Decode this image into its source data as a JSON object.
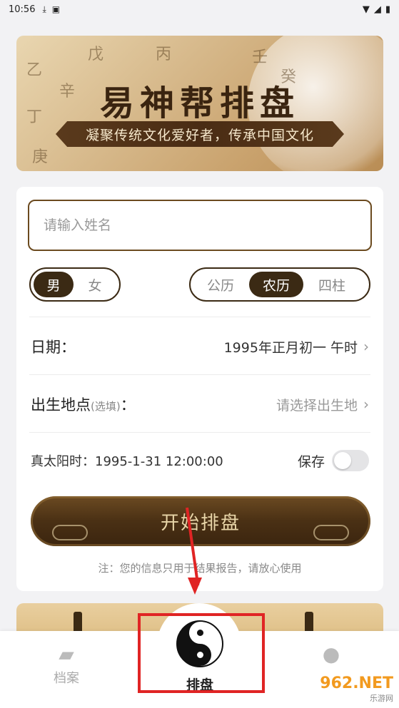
{
  "status_bar": {
    "time": "10:56",
    "icons": [
      "download-icon",
      "a-icon"
    ],
    "right_icons": [
      "wifi-icon",
      "signal-icon",
      "battery-icon"
    ]
  },
  "banner": {
    "title": "易神帮排盘",
    "subtitle": "凝聚传统文化爱好者，传承中国文化",
    "bg_chars": [
      "戊",
      "丙",
      "乙",
      "辛",
      "丁",
      "庚",
      "壬",
      "癸"
    ]
  },
  "form": {
    "name_placeholder": "请输入姓名",
    "gender": {
      "options": [
        "男",
        "女"
      ],
      "selected": "男"
    },
    "calendar": {
      "options": [
        "公历",
        "农历",
        "四柱"
      ],
      "selected": "农历"
    },
    "date_label": "日期：",
    "date_value": "1995年正月初一 午时",
    "place_label": "出生地点",
    "place_optional": "(选填)",
    "place_colon": "：",
    "place_placeholder": "请选择出生地",
    "solar_time": "真太阳时：1995-1-31 12:00:00",
    "save_label": "保存",
    "save_enabled": false,
    "start_button": "开始排盘",
    "note": "注：您的信息只用于结果报告，请放心使用"
  },
  "tabbar": {
    "tabs": [
      {
        "label": "档案",
        "icon": "folder-icon"
      },
      {
        "label": "排盘",
        "icon": "taiji-icon"
      },
      {
        "label": "",
        "icon": "person-icon"
      }
    ]
  },
  "watermark": {
    "brand": "962.NET",
    "sub": "乐游网"
  },
  "colors": {
    "accent_dark": "#3b2a14",
    "annotation": "#e02424",
    "background": "#f2f2f4"
  }
}
